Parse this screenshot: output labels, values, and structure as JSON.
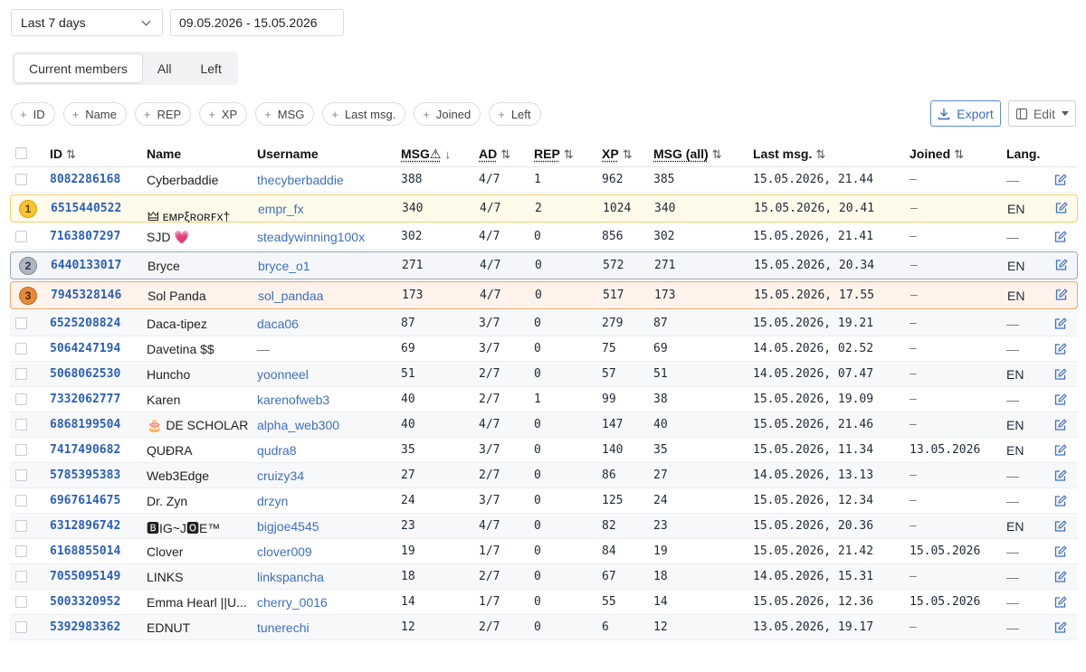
{
  "filters": {
    "period": "Last 7 days",
    "date_range": "09.05.2026 - 15.05.2026"
  },
  "tabs": [
    "Current members",
    "All",
    "Left"
  ],
  "chips": [
    "ID",
    "Name",
    "REP",
    "XP",
    "MSG",
    "Last msg.",
    "Joined",
    "Left"
  ],
  "actions": {
    "export": "Export",
    "edit": "Edit"
  },
  "columns": {
    "id": "ID",
    "name": "Name",
    "username": "Username",
    "msg": "MSG⚠",
    "ad": "AD",
    "rep": "REP",
    "xp": "XP",
    "msgall": "MSG (all)",
    "last": "Last msg.",
    "joined": "Joined",
    "lang": "Lang."
  },
  "sort_icons": {
    "asc_desc": "⇅",
    "down": "↓"
  },
  "rows": [
    {
      "id": "8082286168",
      "name": "Cyberbaddie",
      "username": "thecyberbaddie",
      "msg": "388",
      "ad": "4/7",
      "rep": "1",
      "xp": "962",
      "msgall": "385",
      "last": "15.05.2026, 21.44",
      "joined": "—",
      "lang": "—"
    },
    {
      "id": "6515440522",
      "name": "🜲 ᴇᴍᴘξʀᴏʀꜰx†",
      "username": "empr_fx",
      "msg": "340",
      "ad": "4/7",
      "rep": "2",
      "xp": "1024",
      "msgall": "340",
      "last": "15.05.2026, 20.41",
      "joined": "—",
      "lang": "EN",
      "medal": "1"
    },
    {
      "id": "7163807297",
      "name": "SJD 💗",
      "username": "steadywinning100x",
      "msg": "302",
      "ad": "4/7",
      "rep": "0",
      "xp": "856",
      "msgall": "302",
      "last": "15.05.2026, 21.41",
      "joined": "—",
      "lang": "—"
    },
    {
      "id": "6440133017",
      "name": "Bryce",
      "username": "bryce_o1",
      "msg": "271",
      "ad": "4/7",
      "rep": "0",
      "xp": "572",
      "msgall": "271",
      "last": "15.05.2026, 20.34",
      "joined": "—",
      "lang": "EN",
      "medal": "2"
    },
    {
      "id": "7945328146",
      "name": "Sol Panda",
      "username": "sol_pandaa",
      "msg": "173",
      "ad": "4/7",
      "rep": "0",
      "xp": "517",
      "msgall": "173",
      "last": "15.05.2026, 17.55",
      "joined": "—",
      "lang": "EN",
      "medal": "3"
    },
    {
      "id": "6525208824",
      "name": "Daca-tipez",
      "username": "daca06",
      "msg": "87",
      "ad": "3/7",
      "rep": "0",
      "xp": "279",
      "msgall": "87",
      "last": "15.05.2026, 19.21",
      "joined": "—",
      "lang": "—"
    },
    {
      "id": "5064247194",
      "name": "Davetina $$",
      "username": "—",
      "msg": "69",
      "ad": "3/7",
      "rep": "0",
      "xp": "75",
      "msgall": "69",
      "last": "14.05.2026, 02.52",
      "joined": "—",
      "lang": "—"
    },
    {
      "id": "5068062530",
      "name": "Huncho",
      "username": "yoonneel",
      "msg": "51",
      "ad": "2/7",
      "rep": "0",
      "xp": "57",
      "msgall": "51",
      "last": "14.05.2026, 07.47",
      "joined": "—",
      "lang": "EN"
    },
    {
      "id": "7332062777",
      "name": "Karen",
      "username": "karenofweb3",
      "msg": "40",
      "ad": "2/7",
      "rep": "1",
      "xp": "99",
      "msgall": "38",
      "last": "15.05.2026, 19.09",
      "joined": "—",
      "lang": "—"
    },
    {
      "id": "6868199504",
      "name": "🎂 DE SCHOLAR...",
      "username": "alpha_web300",
      "msg": "40",
      "ad": "4/7",
      "rep": "0",
      "xp": "147",
      "msgall": "40",
      "last": "15.05.2026, 21.46",
      "joined": "—",
      "lang": "EN"
    },
    {
      "id": "7417490682",
      "name": "QUĐRA",
      "username": "qudra8",
      "msg": "35",
      "ad": "3/7",
      "rep": "0",
      "xp": "140",
      "msgall": "35",
      "last": "15.05.2026, 11.34",
      "joined": "13.05.2026",
      "lang": "EN"
    },
    {
      "id": "5785395383",
      "name": "Web3Edge",
      "username": "cruizy34",
      "msg": "27",
      "ad": "2/7",
      "rep": "0",
      "xp": "86",
      "msgall": "27",
      "last": "14.05.2026, 13.13",
      "joined": "—",
      "lang": "—"
    },
    {
      "id": "6967614675",
      "name": "Dr. Zyn",
      "username": "drzyn",
      "msg": "24",
      "ad": "3/7",
      "rep": "0",
      "xp": "125",
      "msgall": "24",
      "last": "15.05.2026, 12.34",
      "joined": "—",
      "lang": "—"
    },
    {
      "id": "6312896742",
      "name": "🅱IG~J🅾E™",
      "username": "bigjoe4545",
      "msg": "23",
      "ad": "4/7",
      "rep": "0",
      "xp": "82",
      "msgall": "23",
      "last": "15.05.2026, 20.36",
      "joined": "—",
      "lang": "EN"
    },
    {
      "id": "6168855014",
      "name": "Clover",
      "username": "clover009",
      "msg": "19",
      "ad": "1/7",
      "rep": "0",
      "xp": "84",
      "msgall": "19",
      "last": "15.05.2026, 21.42",
      "joined": "15.05.2026",
      "lang": "—"
    },
    {
      "id": "7055095149",
      "name": "LINKS",
      "username": "linkspancha",
      "msg": "18",
      "ad": "2/7",
      "rep": "0",
      "xp": "67",
      "msgall": "18",
      "last": "14.05.2026, 15.31",
      "joined": "—",
      "lang": "—"
    },
    {
      "id": "5003320952",
      "name": "Emma Hearl ||U...",
      "username": "cherry_0016",
      "msg": "14",
      "ad": "1/7",
      "rep": "0",
      "xp": "55",
      "msgall": "14",
      "last": "15.05.2026, 12.36",
      "joined": "15.05.2026",
      "lang": "—"
    },
    {
      "id": "5392983362",
      "name": "EDNUT",
      "username": "tunerechi",
      "msg": "12",
      "ad": "2/7",
      "rep": "0",
      "xp": "6",
      "msgall": "12",
      "last": "13.05.2026, 19.17",
      "joined": "—",
      "lang": "—"
    }
  ],
  "colors": {
    "accent": "#2b5fb8",
    "link": "#3f6fbf",
    "gold": "#f7c531",
    "silver": "#aeb6c2",
    "bronze": "#e58a3c"
  },
  "icons": {
    "edit": "pencil-square-icon",
    "export": "download-icon",
    "edit_menu": "columns-icon"
  }
}
